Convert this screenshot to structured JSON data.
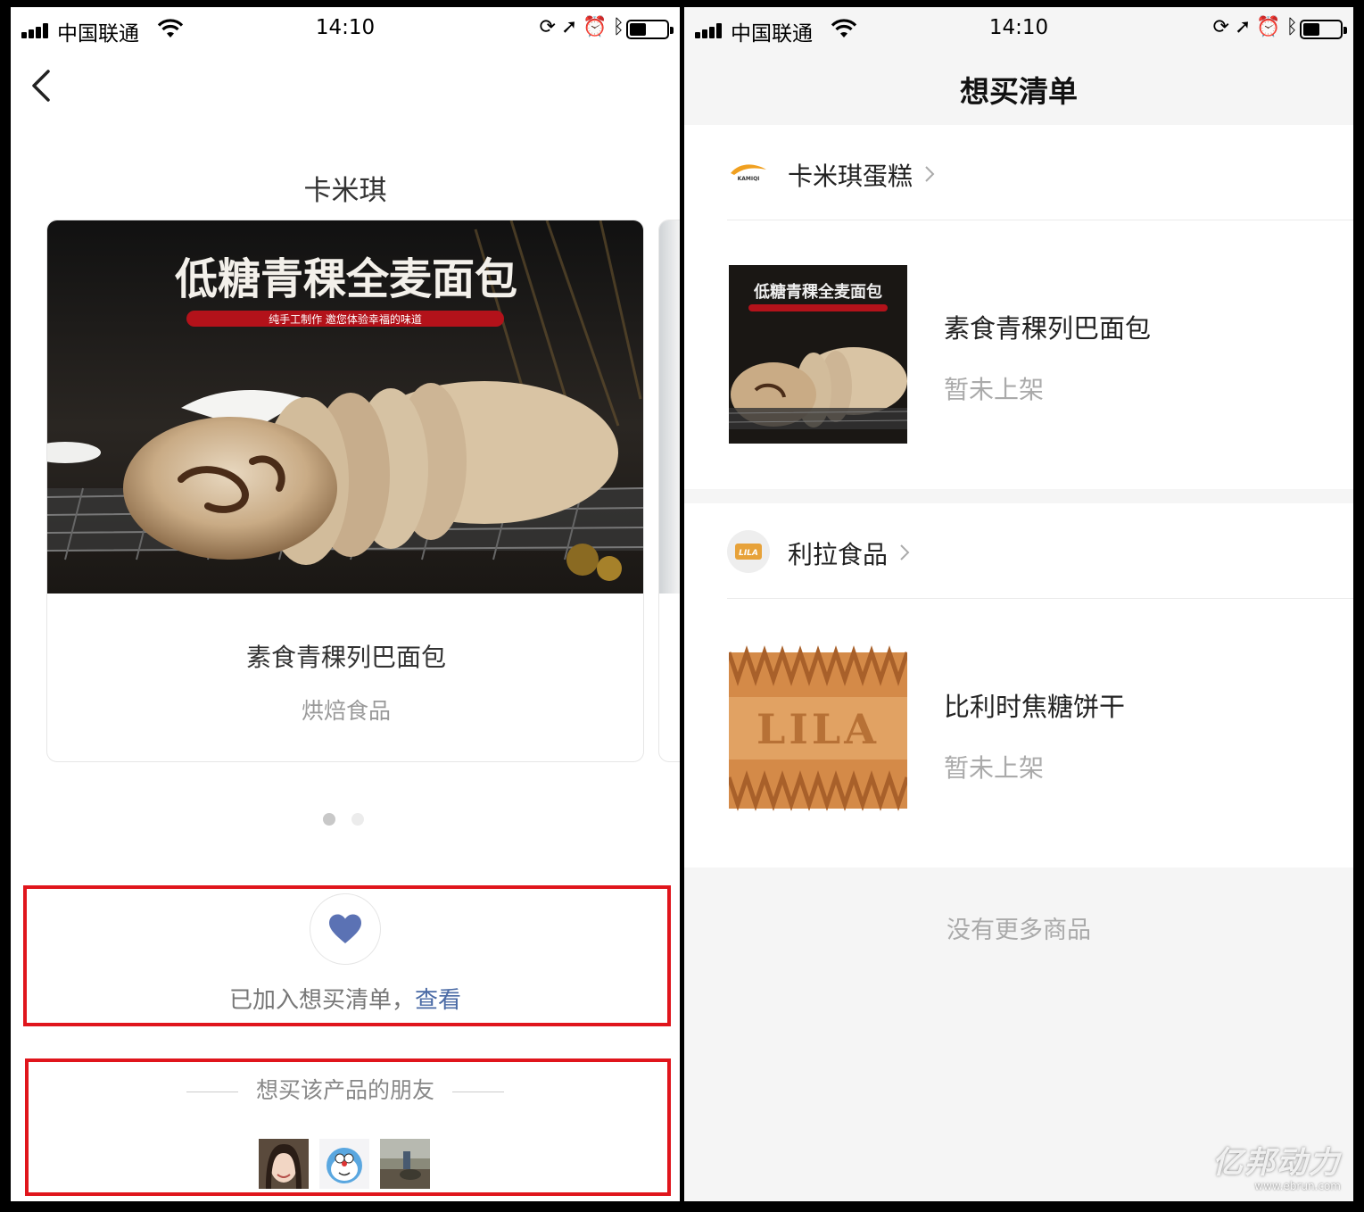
{
  "left_screen": {
    "status": {
      "carrier": "中国联通",
      "time": "14:10"
    },
    "brand_title": "卡米琪",
    "card": {
      "banner_title": "低糖青稞全麦面包",
      "banner_tagline": "纯手工制作 邀您体验幸福的味道",
      "name": "素食青稞列巴面包",
      "category": "烘焙食品"
    },
    "pagination": {
      "count": 2,
      "active": 0
    },
    "wishlist": {
      "added_text": "已加入想买清单，",
      "view_link": "查看",
      "heart_color": "#5b72b4"
    },
    "friends": {
      "title": "想买该产品的朋友",
      "avatars": [
        "avatar-woman",
        "avatar-doraemon",
        "avatar-scene"
      ]
    },
    "highlight_color": "#e0151c"
  },
  "right_screen": {
    "status": {
      "carrier": "中国联通",
      "time": "14:10"
    },
    "nav_title": "想买清单",
    "shops": [
      {
        "name": "卡米琪蛋糕",
        "logo_text": "KAMIQI",
        "items": [
          {
            "name": "素食青稞列巴面包",
            "status": "暂未上架"
          }
        ]
      },
      {
        "name": "利拉食品",
        "logo_text": "LILA",
        "items": [
          {
            "name": "比利时焦糖饼干",
            "status": "暂未上架",
            "thumb_text": "LILA"
          }
        ]
      }
    ],
    "footer": "没有更多商品"
  },
  "watermark": {
    "cn": "亿邦动力",
    "url": "www.ebrun.com"
  }
}
